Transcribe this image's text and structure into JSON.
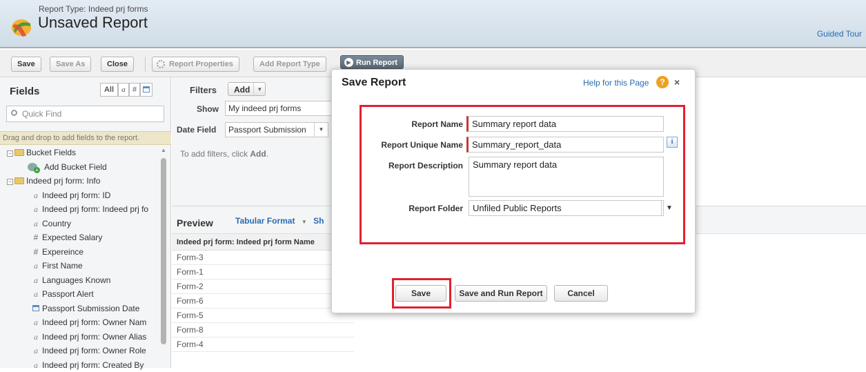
{
  "header": {
    "report_type": "Report Type: Indeed prj forms",
    "title": "Unsaved Report",
    "guided_tour": "Guided Tour"
  },
  "toolbar": {
    "save": "Save",
    "save_as": "Save As",
    "close": "Close",
    "report_properties": "Report Properties",
    "add_report_type": "Add Report Type",
    "run_report": "Run Report"
  },
  "fields": {
    "title": "Fields",
    "filter_all": "All",
    "filter_text": "a",
    "filter_number": "#",
    "quick_find_placeholder": "Quick Find",
    "drag_hint": "Drag and drop to add fields to the report.",
    "tree": [
      {
        "label": "Bucket Fields",
        "kind": "folder"
      },
      {
        "label": "Add Bucket Field",
        "kind": "add"
      },
      {
        "label": "Indeed prj form: Info",
        "kind": "folder"
      },
      {
        "label": "Indeed prj form: ID",
        "kind": "text"
      },
      {
        "label": "Indeed prj form: Indeed prj fo",
        "kind": "text"
      },
      {
        "label": "Country",
        "kind": "text"
      },
      {
        "label": "Expected Salary",
        "kind": "number"
      },
      {
        "label": "Expereince",
        "kind": "number"
      },
      {
        "label": "First Name",
        "kind": "text"
      },
      {
        "label": "Languages Known",
        "kind": "text"
      },
      {
        "label": "Passport Alert",
        "kind": "text"
      },
      {
        "label": "Passport Submission Date",
        "kind": "date"
      },
      {
        "label": "Indeed prj form: Owner Nam",
        "kind": "text"
      },
      {
        "label": "Indeed prj form: Owner Alias",
        "kind": "text"
      },
      {
        "label": "Indeed prj form: Owner Role",
        "kind": "text"
      },
      {
        "label": "Indeed prj form: Created By",
        "kind": "text"
      }
    ]
  },
  "filters": {
    "label": "Filters",
    "add": "Add",
    "show_label": "Show",
    "show_value": "My indeed prj forms",
    "date_field_label": "Date Field",
    "date_field_value": "Passport Submission",
    "hint_prefix": "To add filters, click ",
    "hint_link": "Add",
    "hint_suffix": "."
  },
  "preview": {
    "title": "Preview",
    "format": "Tabular Format",
    "format_more": "Sh",
    "column": "Indeed prj form: Indeed prj form Name",
    "rows": [
      "Form-3",
      "Form-1",
      "Form-2",
      "Form-6",
      "Form-5",
      "Form-8",
      "Form-4"
    ]
  },
  "modal": {
    "title": "Save Report",
    "help": "Help for this Page",
    "help_icon": "?",
    "close_icon": "×",
    "report_name_label": "Report Name",
    "report_name_value": "Summary report data",
    "unique_name_label": "Report Unique Name",
    "unique_name_value": "Summary_report_data",
    "description_label": "Report Description",
    "description_value": "Summary report data",
    "folder_label": "Report Folder",
    "folder_value": "Unfiled Public Reports",
    "info_icon": "i",
    "save": "Save",
    "save_and_run": "Save and Run Report",
    "cancel": "Cancel"
  },
  "colors": {
    "highlight": "#e0202f",
    "link": "#2a6bb1",
    "required": "#c23934"
  }
}
